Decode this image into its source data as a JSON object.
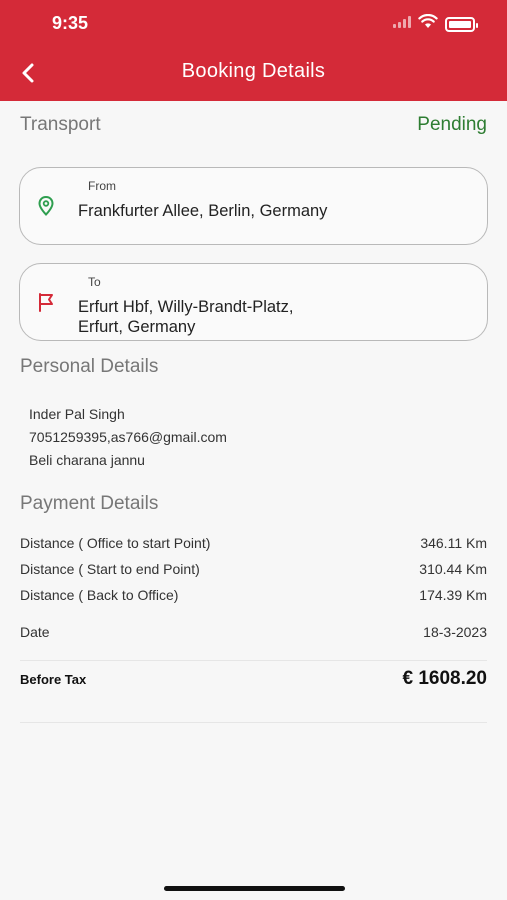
{
  "status_bar": {
    "time": "9:35"
  },
  "header": {
    "title": "Booking Details"
  },
  "transport": {
    "label": "Transport",
    "status": "Pending",
    "status_color": "#2e7d32"
  },
  "from": {
    "label": "From",
    "address": "Frankfurter Allee, Berlin, Germany"
  },
  "to": {
    "label": "To",
    "address": "Erfurt Hbf, Willy-Brandt-Platz, Erfurt, Germany"
  },
  "personal": {
    "title": "Personal Details",
    "name": "Inder Pal Singh",
    "contact": "7051259395,as766@gmail.com",
    "address": "Beli charana jannu"
  },
  "payment": {
    "title": "Payment Details",
    "rows": [
      {
        "label": "Distance ( Office to start Point)",
        "value": "346.11 Km"
      },
      {
        "label": "Distance ( Start to end Point)",
        "value": "310.44 Km"
      },
      {
        "label": "Distance ( Back to Office)",
        "value": "174.39 Km"
      },
      {
        "label": "Date",
        "value": "18-3-2023"
      }
    ],
    "total_label": "Before Tax",
    "total_value": "€ 1608.20"
  },
  "colors": {
    "brand": "#d42a38",
    "from_icon": "#2e9e4f",
    "to_icon": "#d42a38"
  }
}
